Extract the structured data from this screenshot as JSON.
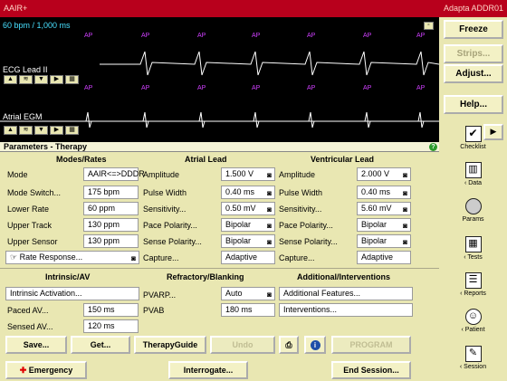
{
  "titlebar": {
    "left": "AAIR+",
    "right": "Adapta ADDR01"
  },
  "ecg": {
    "rate_text": "60 bpm / 1,000 ms",
    "lead1": "ECG Lead II",
    "lead2": "Atrial EGM",
    "beat_label": "AP"
  },
  "right": {
    "freeze": "Freeze",
    "strips": "Strips...",
    "adjust": "Adjust...",
    "help": "Help...",
    "nav": [
      {
        "label": "Checklist",
        "icon": "checklist-icon"
      },
      {
        "label": "‹ Data",
        "icon": "data-icon"
      },
      {
        "label": "Params",
        "icon": "params-icon"
      },
      {
        "label": "‹ Tests",
        "icon": "tests-icon"
      },
      {
        "label": "‹ Reports",
        "icon": "reports-icon"
      },
      {
        "label": "‹ Patient",
        "icon": "patient-icon"
      },
      {
        "label": "‹ Session",
        "icon": "session-icon"
      }
    ]
  },
  "panel": {
    "title": "Parameters - Therapy",
    "modes": {
      "header": "Modes/Rates",
      "rows": [
        {
          "label": "Mode",
          "value": "AAIR<=>DDDR"
        },
        {
          "label": "Mode Switch...",
          "value": "175 bpm"
        },
        {
          "label": "Lower Rate",
          "value": "60 ppm"
        },
        {
          "label": "Upper Track",
          "value": "130 ppm"
        },
        {
          "label": "Upper Sensor",
          "value": "130 ppm"
        }
      ],
      "rate_response": "Rate Response..."
    },
    "atrial": {
      "header": "Atrial Lead",
      "rows": [
        {
          "label": "Amplitude",
          "value": "1.500 V"
        },
        {
          "label": "Pulse Width",
          "value": "0.40 ms"
        },
        {
          "label": "Sensitivity...",
          "value": "0.50 mV"
        },
        {
          "label": "Pace Polarity...",
          "value": "Bipolar"
        },
        {
          "label": "Sense Polarity...",
          "value": "Bipolar"
        },
        {
          "label": "Capture...",
          "value": "Adaptive"
        }
      ]
    },
    "ventricular": {
      "header": "Ventricular Lead",
      "rows": [
        {
          "label": "Amplitude",
          "value": "2.000 V"
        },
        {
          "label": "Pulse Width",
          "value": "0.40 ms"
        },
        {
          "label": "Sensitivity...",
          "value": "5.60 mV"
        },
        {
          "label": "Pace Polarity...",
          "value": "Bipolar"
        },
        {
          "label": "Sense Polarity...",
          "value": "Bipolar"
        },
        {
          "label": "Capture...",
          "value": "Adaptive"
        }
      ]
    },
    "intrinsic": {
      "header": "Intrinsic/AV",
      "activation": "Intrinsic Activation...",
      "rows": [
        {
          "label": "Paced AV...",
          "value": "150 ms"
        },
        {
          "label": "Sensed AV...",
          "value": "120 ms"
        }
      ]
    },
    "refractory": {
      "header": "Refractory/Blanking",
      "rows": [
        {
          "label": "PVARP...",
          "value": "Auto"
        },
        {
          "label": "PVAB",
          "value": "180 ms"
        }
      ]
    },
    "additional": {
      "header": "Additional/Interventions",
      "features": "Additional Features...",
      "interventions": "Interventions..."
    }
  },
  "buttons": {
    "save": "Save...",
    "get": "Get...",
    "guide": "TherapyGuide",
    "undo": "Undo",
    "program": "PROGRAM",
    "info": "i"
  },
  "footer": {
    "emergency": "Emergency",
    "interrogate": "Interrogate...",
    "end": "End Session..."
  }
}
